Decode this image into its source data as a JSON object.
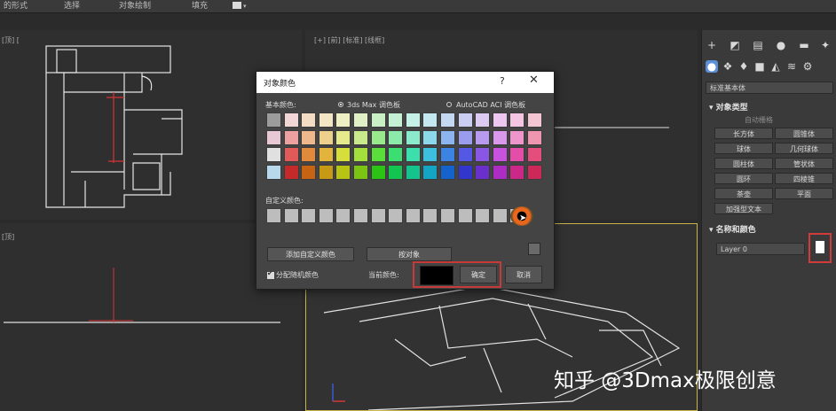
{
  "menubar": {
    "items": [
      "的形式",
      "选择",
      "对象绘制",
      "填充"
    ]
  },
  "viewports": {
    "top_left_label": "[顶] [",
    "top_right_label": "[+] [前] [标准] [线框]",
    "bottom_left_label": "[顶]"
  },
  "right_panel": {
    "dropdown": "标准基本体",
    "object_type_title": "对象类型",
    "autogrid": "自动栅格",
    "buttons": [
      "长方体",
      "圆锥体",
      "球体",
      "几何球体",
      "圆柱体",
      "管状体",
      "圆环",
      "四棱锥",
      "茶壶",
      "平面",
      "加强型文本"
    ],
    "name_color_title": "名称和颜色",
    "layer_name": "Layer 0",
    "layer_color": "#ffffff"
  },
  "dialog": {
    "title": "对象颜色",
    "help": "?",
    "close": "✕",
    "basic_colors_label": "基本颜色:",
    "palette_option_1": "3ds Max 调色板",
    "palette_option_2": "AutoCAD ACI 调色板",
    "selected_palette": "3ds Max 调色板",
    "palette_rows": [
      [
        "#9c9c9c",
        "#f2d6d6",
        "#f4dcc4",
        "#f2e6c4",
        "#eef0c4",
        "#e0f0c4",
        "#c8f0c4",
        "#c4f0d4",
        "#c4f0e6",
        "#c4e8f0",
        "#c4d8f2",
        "#cccdf2",
        "#dccaf2",
        "#ecc8f0",
        "#f4c6e4",
        "#f4c6d4"
      ],
      [
        "#e8c8d4",
        "#eda0a0",
        "#efb88c",
        "#edd08c",
        "#e6ea8c",
        "#c8ea8c",
        "#98ea8c",
        "#8ceaaa",
        "#8ceacc",
        "#8cd8ea",
        "#8cb4ee",
        "#9a9cee",
        "#b89aee",
        "#da98ea",
        "#ee96cc",
        "#ee96b0"
      ],
      [
        "#e0e0e0",
        "#e05a5a",
        "#e28a3c",
        "#e2b43c",
        "#d6de3c",
        "#a4de3c",
        "#5ade3c",
        "#3cde72",
        "#3cdeac",
        "#3cc0de",
        "#3c84e4",
        "#5458e4",
        "#8a56e4",
        "#c652de",
        "#e44ea8",
        "#e44e7c"
      ],
      [
        "#b8d8ec",
        "#c42a2a",
        "#c66414",
        "#c69a14",
        "#b8c414",
        "#7cc414",
        "#2cc414",
        "#14c450",
        "#14c48c",
        "#14a4c4",
        "#1462cc",
        "#3236cc",
        "#6a30cc",
        "#ac2cc4",
        "#cc2888",
        "#cc2858"
      ]
    ],
    "custom_colors_label": "自定义颜色:",
    "custom_color_count": 16,
    "custom_color": "#bdbdbd",
    "add_custom_button": "添加自定义颜色",
    "pick_object_button": "按对象",
    "random_checkbox_label": "分配随机颜色",
    "random_checked": true,
    "current_color_label": "当前颜色:",
    "current_color": "#000000",
    "ok_button": "确定",
    "cancel_button": "取消"
  },
  "watermark": "知乎 @3Dmax极限创意",
  "colors": {
    "highlight": "#c63a3a",
    "viewport_bg": "#2f2f2f",
    "panel_bg": "#3a3a3a",
    "dialog_bg": "#444444"
  }
}
